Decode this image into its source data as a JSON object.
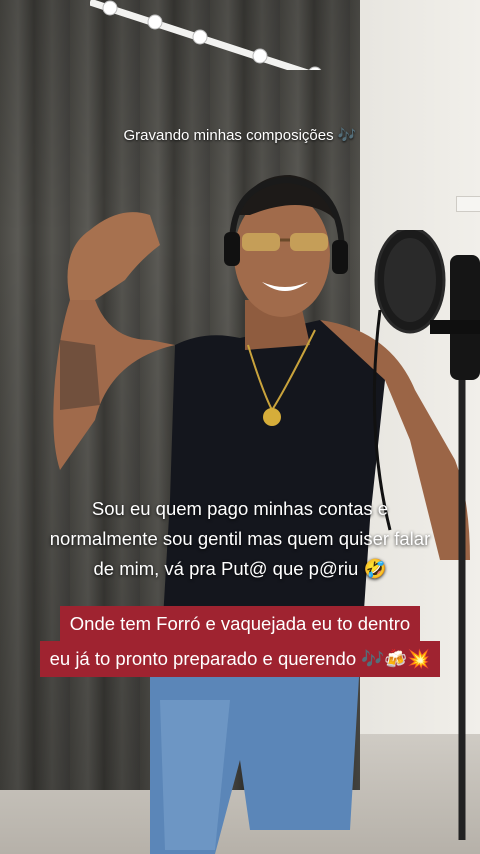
{
  "video": {
    "top_caption": "Gravando minhas composições",
    "top_caption_emoji": "🎶",
    "mid_caption_lines": [
      "Sou eu quem pago minhas contas e",
      "normalmente sou gentil mas quem quiser falar",
      "de mim, vá pra Put@ que p@riu"
    ],
    "mid_caption_emoji": "🤣",
    "banner_lines": [
      "Onde tem Forró e vaquejada eu to dentro",
      "eu já to pronto preparado e querendo"
    ],
    "banner_emoji": "🎶🍻💥",
    "colors": {
      "banner_bg": "#9f2330",
      "caption_text": "#ffffff"
    }
  }
}
